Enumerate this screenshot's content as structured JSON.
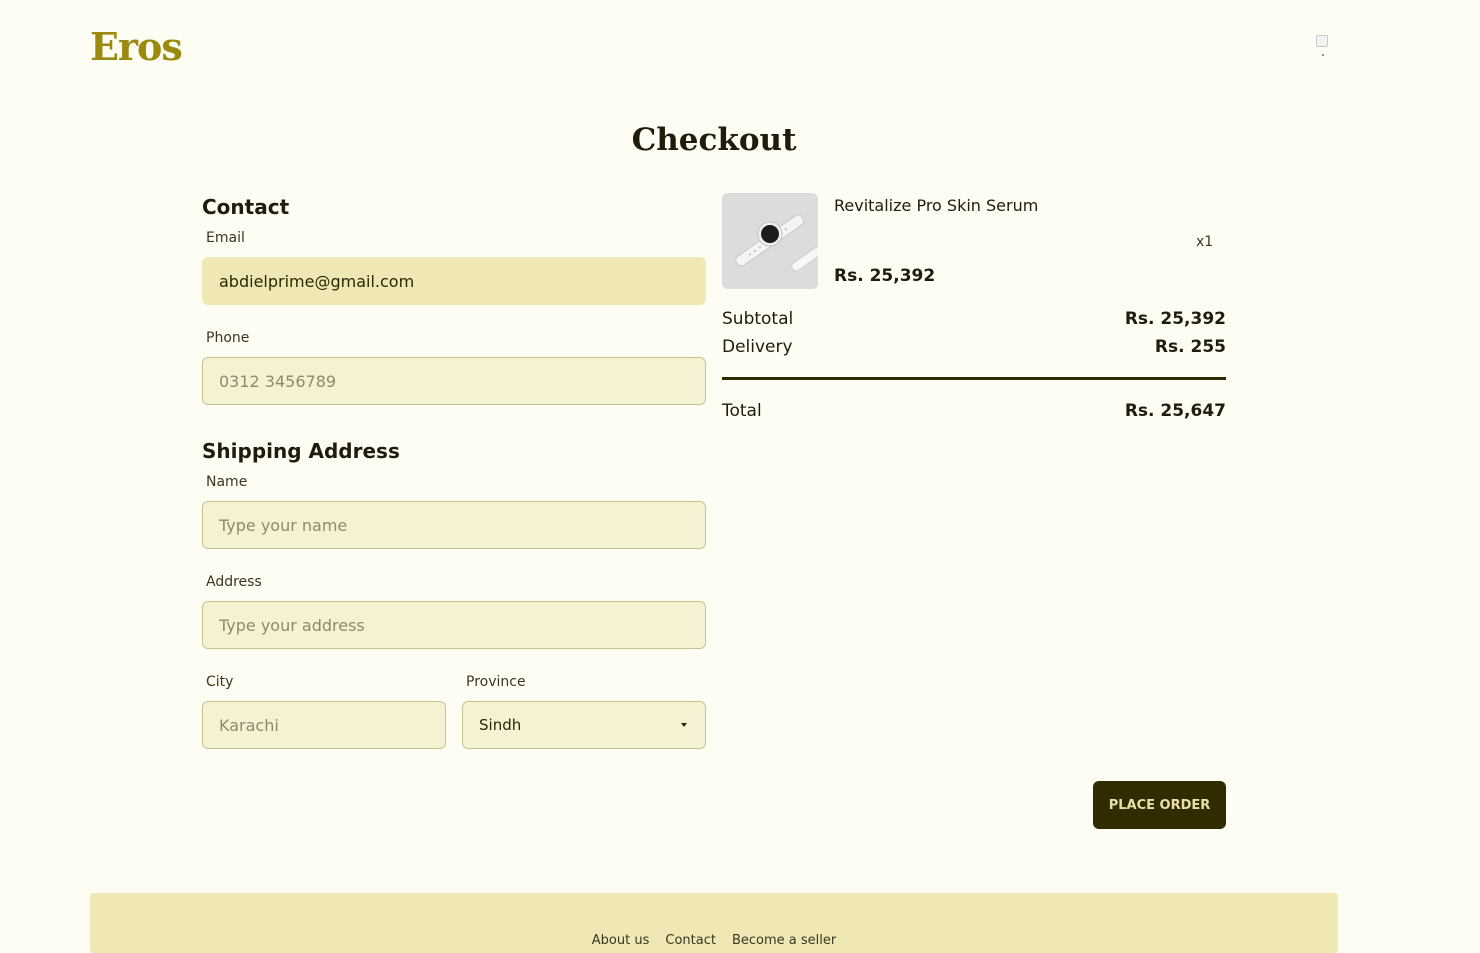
{
  "brand": {
    "logo_text": "Eros"
  },
  "header": {
    "avatar_icon": "broken-image-icon"
  },
  "page": {
    "title": "Checkout"
  },
  "contact": {
    "heading": "Contact",
    "email_label": "Email",
    "email_value": "abdielprime@gmail.com",
    "phone_label": "Phone",
    "phone_placeholder": "0312 3456789"
  },
  "shipping": {
    "heading": "Shipping Address",
    "name_label": "Name",
    "name_placeholder": "Type your name",
    "address_label": "Address",
    "address_placeholder": "Type your address",
    "city_label": "City",
    "city_placeholder": "Karachi",
    "province_label": "Province",
    "province_value": "Sindh"
  },
  "order": {
    "product_name": "Revitalize Pro Skin Serum",
    "product_quantity": "x1",
    "product_price": "Rs. 25,392",
    "product_image": "smartwatch-image",
    "subtotal_label": "Subtotal",
    "subtotal_value": "Rs. 25,392",
    "delivery_label": "Delivery",
    "delivery_value": "Rs. 255",
    "total_label": "Total",
    "total_value": "Rs. 25,647"
  },
  "actions": {
    "place_order_label": "PLACE ORDER"
  },
  "footer": {
    "links": [
      "About us",
      "Contact",
      "Become a seller"
    ]
  },
  "colors": {
    "background": "#fefdf3",
    "brand": "#9a8a0e",
    "input_bg": "#f5f2d4",
    "input_filled_bg": "#efe8b4",
    "button_bg": "#312c00",
    "footer_bg": "#efe8b4"
  }
}
